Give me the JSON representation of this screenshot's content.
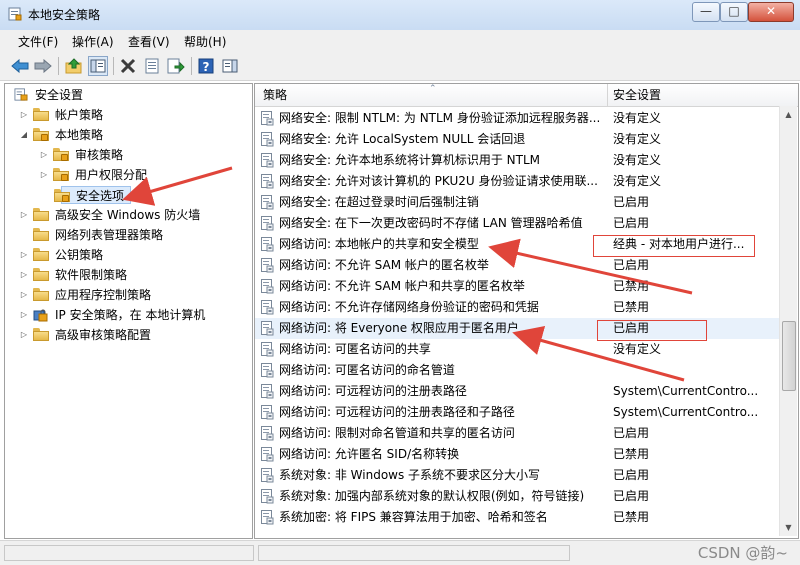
{
  "window": {
    "title": "本地安全策略"
  },
  "menu": [
    "文件(F)",
    "操作(A)",
    "查看(V)",
    "帮助(H)"
  ],
  "toolbar": [
    {
      "icon": "back-arrow-icon"
    },
    {
      "icon": "forward-arrow-icon"
    },
    {
      "icon": "up-folder-icon"
    },
    {
      "icon": "show-hide-tree-icon"
    },
    {
      "icon": "delete-icon"
    },
    {
      "icon": "properties-icon"
    },
    {
      "icon": "export-list-icon"
    },
    {
      "icon": "help-icon"
    },
    {
      "icon": "show-hide-action-pane-icon"
    }
  ],
  "tree": {
    "root": "安全设置",
    "items": [
      {
        "label": "帐户策略",
        "level": 1,
        "expander": "collapsed",
        "icon": "folder-icon"
      },
      {
        "label": "本地策略",
        "level": 1,
        "expander": "expanded",
        "icon": "folder-icon"
      },
      {
        "label": "审核策略",
        "level": 2,
        "expander": "collapsed",
        "icon": "folder-icon"
      },
      {
        "label": "用户权限分配",
        "level": 2,
        "expander": "collapsed",
        "icon": "folder-icon"
      },
      {
        "label": "安全选项",
        "level": 2,
        "expander": "none",
        "icon": "folder-icon",
        "selected": true
      },
      {
        "label": "高级安全 Windows 防火墙",
        "level": 1,
        "expander": "collapsed",
        "icon": "folder-icon"
      },
      {
        "label": "网络列表管理器策略",
        "level": 1,
        "expander": "none",
        "icon": "folder-icon"
      },
      {
        "label": "公钥策略",
        "level": 1,
        "expander": "collapsed",
        "icon": "folder-icon"
      },
      {
        "label": "软件限制策略",
        "level": 1,
        "expander": "collapsed",
        "icon": "folder-icon"
      },
      {
        "label": "应用程序控制策略",
        "level": 1,
        "expander": "collapsed",
        "icon": "folder-icon"
      },
      {
        "label": "IP 安全策略，在 本地计算机",
        "level": 1,
        "expander": "collapsed",
        "icon": "ip-security-icon"
      },
      {
        "label": "高级审核策略配置",
        "level": 1,
        "expander": "collapsed",
        "icon": "folder-icon"
      }
    ]
  },
  "list": {
    "columns": [
      "策略",
      "安全设置"
    ],
    "rows": [
      {
        "name": "网络安全: 限制 NTLM: 为 NTLM 身份验证添加远程服务器...",
        "value": "没有定义"
      },
      {
        "name": "网络安全: 允许 LocalSystem NULL 会话回退",
        "value": "没有定义"
      },
      {
        "name": "网络安全: 允许本地系统将计算机标识用于 NTLM",
        "value": "没有定义"
      },
      {
        "name": "网络安全: 允许对该计算机的 PKU2U 身份验证请求使用联...",
        "value": "没有定义"
      },
      {
        "name": "网络安全: 在超过登录时间后强制注销",
        "value": "已启用"
      },
      {
        "name": "网络安全: 在下一次更改密码时不存储 LAN 管理器哈希值",
        "value": "已启用"
      },
      {
        "name": "网络访问: 本地帐户的共享和安全模型",
        "value": "经典 - 对本地用户进行..."
      },
      {
        "name": "网络访问: 不允许 SAM 帐户的匿名枚举",
        "value": "已启用"
      },
      {
        "name": "网络访问: 不允许 SAM 帐户和共享的匿名枚举",
        "value": "已禁用"
      },
      {
        "name": "网络访问: 不允许存储网络身份验证的密码和凭据",
        "value": "已禁用"
      },
      {
        "name": "网络访问: 将 Everyone 权限应用于匿名用户",
        "value": "已启用",
        "highlighted": true
      },
      {
        "name": "网络访问: 可匿名访问的共享",
        "value": "没有定义"
      },
      {
        "name": "网络访问: 可匿名访问的命名管道",
        "value": ""
      },
      {
        "name": "网络访问: 可远程访问的注册表路径",
        "value": "System\\CurrentContro..."
      },
      {
        "name": "网络访问: 可远程访问的注册表路径和子路径",
        "value": "System\\CurrentContro..."
      },
      {
        "name": "网络访问: 限制对命名管道和共享的匿名访问",
        "value": "已启用"
      },
      {
        "name": "网络访问: 允许匿名 SID/名称转换",
        "value": "已禁用"
      },
      {
        "name": "系统对象: 非 Windows 子系统不要求区分大小写",
        "value": "已启用"
      },
      {
        "name": "系统对象: 加强内部系统对象的默认权限(例如，符号链接)",
        "value": "已启用"
      },
      {
        "name": "系统加密: 将 FIPS 兼容算法用于加密、哈希和签名",
        "value": "已禁用"
      }
    ]
  },
  "watermark": "CSDN @韵~",
  "colors": {
    "annotation": "#e0453a",
    "selection": "#dcebfc"
  }
}
